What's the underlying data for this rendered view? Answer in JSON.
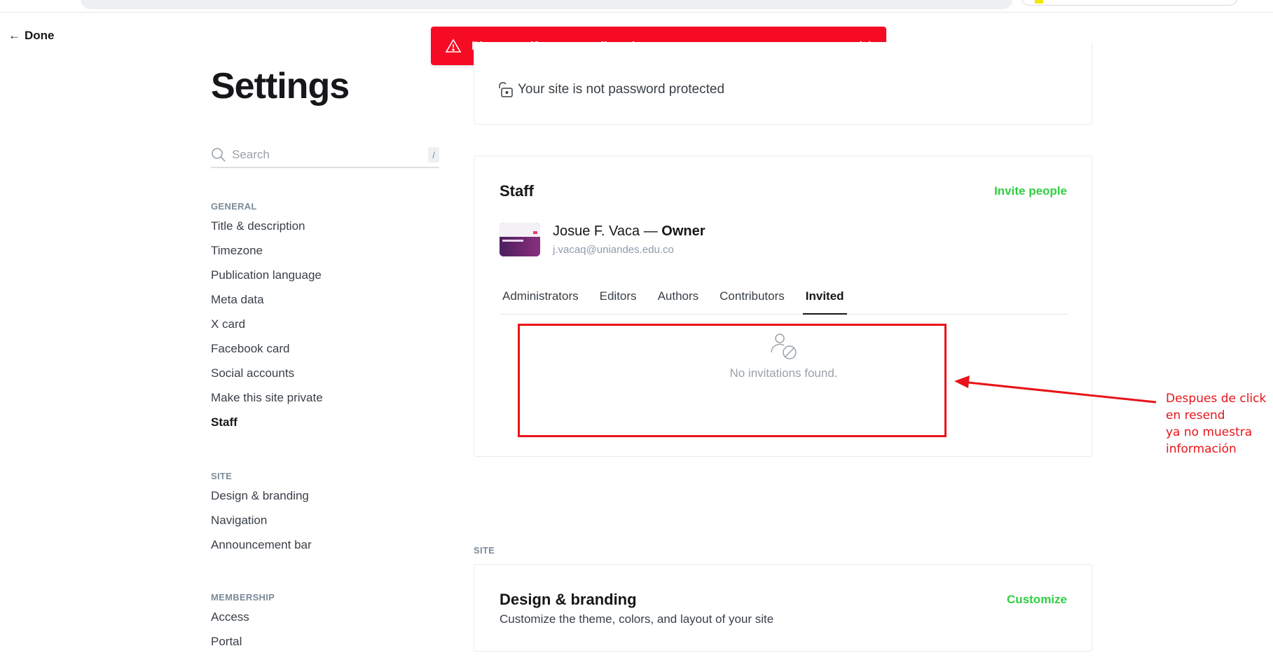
{
  "nav": {
    "done_label": "Done"
  },
  "toast": {
    "message": "Please verify your email settings"
  },
  "sidebar": {
    "title": "Settings",
    "search_placeholder": "Search",
    "search_shortcut": "/",
    "groups": [
      {
        "heading": "GENERAL",
        "items": [
          "Title & description",
          "Timezone",
          "Publication language",
          "Meta data",
          "X card",
          "Facebook card",
          "Social accounts",
          "Make this site private",
          "Staff"
        ]
      },
      {
        "heading": "SITE",
        "items": [
          "Design & branding",
          "Navigation",
          "Announcement bar"
        ]
      },
      {
        "heading": "MEMBERSHIP",
        "items": [
          "Access",
          "Portal"
        ]
      }
    ],
    "active_item": "Staff"
  },
  "privacy": {
    "status_text": "Your site is not password protected"
  },
  "staff": {
    "title": "Staff",
    "invite_label": "Invite people",
    "owner_name": "Josue F. Vaca",
    "owner_separator": " — ",
    "owner_role": "Owner",
    "owner_email": "j.vacaq@uniandes.edu.co",
    "tabs": [
      "Administrators",
      "Editors",
      "Authors",
      "Contributors",
      "Invited"
    ],
    "active_tab": "Invited",
    "empty_text": "No invitations found."
  },
  "site_section": {
    "heading": "SITE",
    "design_title": "Design & branding",
    "design_desc": "Customize the theme, colors, and layout of your site",
    "customize_label": "Customize"
  },
  "annotation": {
    "lines": [
      "Despues de click",
      "en resend",
      "ya no muestra",
      "información"
    ],
    "color": "#e8141a"
  },
  "colors": {
    "accent_green": "#30cf43",
    "toast_red": "#f50b23"
  }
}
